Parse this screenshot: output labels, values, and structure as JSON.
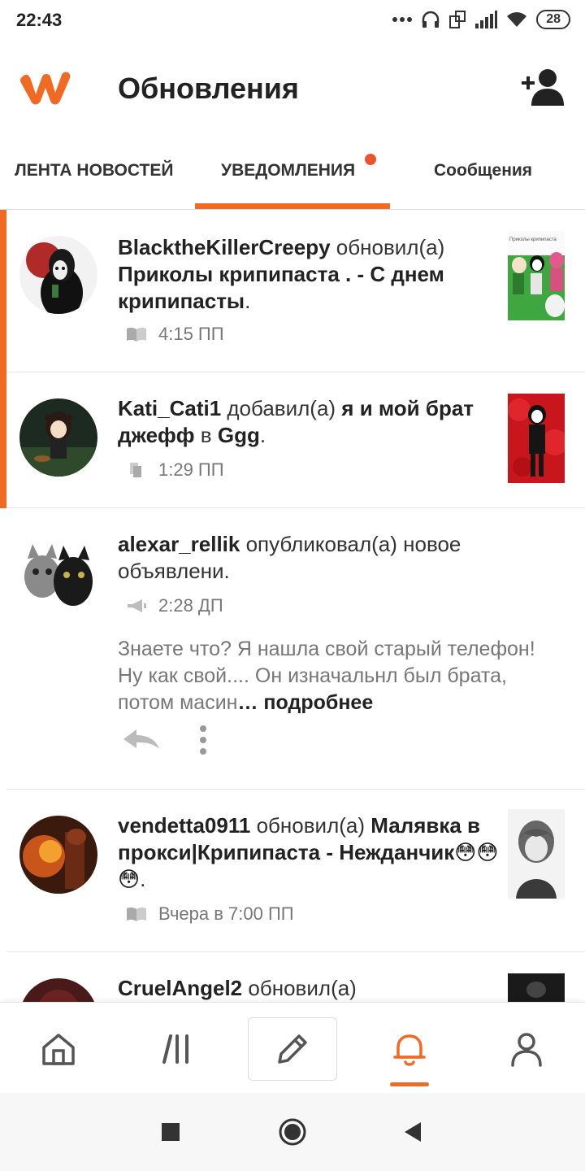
{
  "status_bar": {
    "time": "22:43",
    "battery": "28",
    "icons": [
      "more-dots-icon",
      "headphones-icon",
      "screen-icon",
      "signal-icon",
      "wifi-icon",
      "battery-icon"
    ]
  },
  "header": {
    "title": "Обновления",
    "logo_icon": "wattpad-logo",
    "add_user_icon": "add-user-icon"
  },
  "tabs": [
    {
      "label": "ЛЕНТА НОВОСТЕЙ"
    },
    {
      "label": "УВЕДОМЛЕНИЯ"
    },
    {
      "label": "Сообщения"
    }
  ],
  "feed": [
    {
      "user": "BlacktheKillerCreepy",
      "action": "обновил(а)",
      "story": "Приколы крипипаста . - С днем крипипасты",
      "end": ".",
      "meta_icon": "book-icon",
      "time": "4:15 ПП",
      "unread": true,
      "thumb_caption": "Приколы крипипаста"
    },
    {
      "user": "Kati_Cati1",
      "action": "добавил(а)",
      "story": "я и мой брат джефф",
      "middle": "в",
      "list": "Ggg",
      "end": ".",
      "meta_icon": "reading-list-icon",
      "time": "1:29 ПП",
      "unread": true
    },
    {
      "user": "alexar_rellik",
      "action": "опубликовал(а) новое объявлени.",
      "meta_icon": "megaphone-icon",
      "time": "2:28 ДП",
      "snippet": "Знаете что? Я нашла свой старый телефон! Ну как свой.... Он изначальнл был брата, потом масин",
      "ellipsis": "…",
      "more": "подробнее",
      "unread": false
    },
    {
      "user": "vendetta0911",
      "action": "обновил(а)",
      "story": "Малявка в прокси|Крипипаста - Нежданчик😳😳😳",
      "end": ".",
      "meta_icon": "book-icon",
      "time": "Вчера в 7:00 ПП",
      "unread": false
    },
    {
      "user": "CruelAngel2",
      "action": "обновил(а)",
      "unread": false
    }
  ],
  "bottom_nav": [
    {
      "icon": "home-icon"
    },
    {
      "icon": "library-icon"
    },
    {
      "icon": "pencil-icon"
    },
    {
      "icon": "bell-icon",
      "active": true
    },
    {
      "icon": "profile-icon"
    }
  ],
  "colors": {
    "accent": "#f06a24",
    "notification_dot": "#ea5530"
  }
}
